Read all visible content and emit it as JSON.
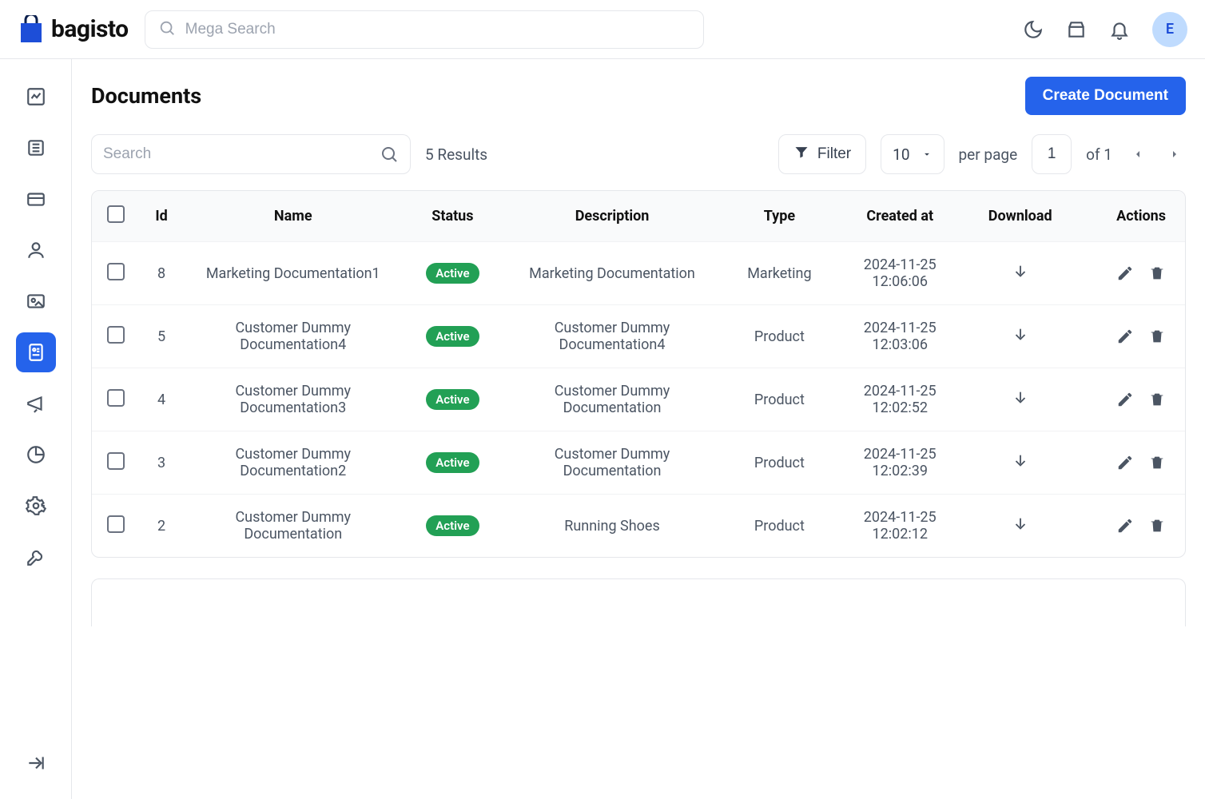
{
  "brand": {
    "name": "bagisto",
    "avatar_initial": "E"
  },
  "search": {
    "mega_placeholder": "Mega Search"
  },
  "page": {
    "title": "Documents",
    "create_label": "Create Document"
  },
  "toolbar": {
    "search_placeholder": "Search",
    "results_text": "5 Results",
    "filter_label": "Filter",
    "perpage_value": "10",
    "perpage_label": "per page",
    "page_current": "1",
    "page_of_label": "of 1"
  },
  "columns": {
    "id": "Id",
    "name": "Name",
    "status": "Status",
    "description": "Description",
    "type": "Type",
    "created_at": "Created at",
    "download": "Download",
    "actions": "Actions"
  },
  "status_labels": {
    "active": "Active"
  },
  "rows": [
    {
      "id": "8",
      "name": "Marketing Documentation1",
      "status": "active",
      "description": "Marketing Documentation",
      "type": "Marketing",
      "created_at": "2024-11-25 12:06:06"
    },
    {
      "id": "5",
      "name": "Customer Dummy Documentation4",
      "status": "active",
      "description": "Customer Dummy Documentation4",
      "type": "Product",
      "created_at": "2024-11-25 12:03:06"
    },
    {
      "id": "4",
      "name": "Customer Dummy Documentation3",
      "status": "active",
      "description": "Customer Dummy Documentation",
      "type": "Product",
      "created_at": "2024-11-25 12:02:52"
    },
    {
      "id": "3",
      "name": "Customer Dummy Documentation2",
      "status": "active",
      "description": "Customer Dummy Documentation",
      "type": "Product",
      "created_at": "2024-11-25 12:02:39"
    },
    {
      "id": "2",
      "name": "Customer Dummy Documentation",
      "status": "active",
      "description": "Running Shoes",
      "type": "Product",
      "created_at": "2024-11-25 12:02:12"
    }
  ],
  "sidebar": {
    "items": [
      {
        "name": "dashboard",
        "active": false
      },
      {
        "name": "catalog",
        "active": false
      },
      {
        "name": "orders",
        "active": false
      },
      {
        "name": "customers",
        "active": false
      },
      {
        "name": "cms",
        "active": false
      },
      {
        "name": "documents",
        "active": true
      },
      {
        "name": "marketing",
        "active": false
      },
      {
        "name": "reports",
        "active": false
      },
      {
        "name": "settings",
        "active": false
      },
      {
        "name": "tools",
        "active": false
      }
    ]
  }
}
